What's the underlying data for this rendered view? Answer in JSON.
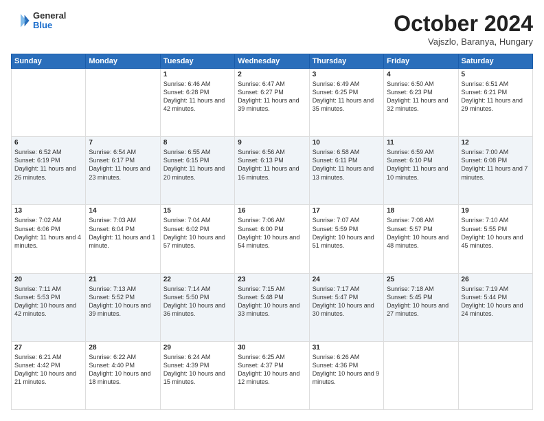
{
  "logo": {
    "general": "General",
    "blue": "Blue"
  },
  "title": "October 2024",
  "location": "Vajszlo, Baranya, Hungary",
  "days_of_week": [
    "Sunday",
    "Monday",
    "Tuesday",
    "Wednesday",
    "Thursday",
    "Friday",
    "Saturday"
  ],
  "weeks": [
    [
      {
        "day": "",
        "info": ""
      },
      {
        "day": "",
        "info": ""
      },
      {
        "day": "1",
        "info": "Sunrise: 6:46 AM\nSunset: 6:28 PM\nDaylight: 11 hours and 42 minutes."
      },
      {
        "day": "2",
        "info": "Sunrise: 6:47 AM\nSunset: 6:27 PM\nDaylight: 11 hours and 39 minutes."
      },
      {
        "day": "3",
        "info": "Sunrise: 6:49 AM\nSunset: 6:25 PM\nDaylight: 11 hours and 35 minutes."
      },
      {
        "day": "4",
        "info": "Sunrise: 6:50 AM\nSunset: 6:23 PM\nDaylight: 11 hours and 32 minutes."
      },
      {
        "day": "5",
        "info": "Sunrise: 6:51 AM\nSunset: 6:21 PM\nDaylight: 11 hours and 29 minutes."
      }
    ],
    [
      {
        "day": "6",
        "info": "Sunrise: 6:52 AM\nSunset: 6:19 PM\nDaylight: 11 hours and 26 minutes."
      },
      {
        "day": "7",
        "info": "Sunrise: 6:54 AM\nSunset: 6:17 PM\nDaylight: 11 hours and 23 minutes."
      },
      {
        "day": "8",
        "info": "Sunrise: 6:55 AM\nSunset: 6:15 PM\nDaylight: 11 hours and 20 minutes."
      },
      {
        "day": "9",
        "info": "Sunrise: 6:56 AM\nSunset: 6:13 PM\nDaylight: 11 hours and 16 minutes."
      },
      {
        "day": "10",
        "info": "Sunrise: 6:58 AM\nSunset: 6:11 PM\nDaylight: 11 hours and 13 minutes."
      },
      {
        "day": "11",
        "info": "Sunrise: 6:59 AM\nSunset: 6:10 PM\nDaylight: 11 hours and 10 minutes."
      },
      {
        "day": "12",
        "info": "Sunrise: 7:00 AM\nSunset: 6:08 PM\nDaylight: 11 hours and 7 minutes."
      }
    ],
    [
      {
        "day": "13",
        "info": "Sunrise: 7:02 AM\nSunset: 6:06 PM\nDaylight: 11 hours and 4 minutes."
      },
      {
        "day": "14",
        "info": "Sunrise: 7:03 AM\nSunset: 6:04 PM\nDaylight: 11 hours and 1 minute."
      },
      {
        "day": "15",
        "info": "Sunrise: 7:04 AM\nSunset: 6:02 PM\nDaylight: 10 hours and 57 minutes."
      },
      {
        "day": "16",
        "info": "Sunrise: 7:06 AM\nSunset: 6:00 PM\nDaylight: 10 hours and 54 minutes."
      },
      {
        "day": "17",
        "info": "Sunrise: 7:07 AM\nSunset: 5:59 PM\nDaylight: 10 hours and 51 minutes."
      },
      {
        "day": "18",
        "info": "Sunrise: 7:08 AM\nSunset: 5:57 PM\nDaylight: 10 hours and 48 minutes."
      },
      {
        "day": "19",
        "info": "Sunrise: 7:10 AM\nSunset: 5:55 PM\nDaylight: 10 hours and 45 minutes."
      }
    ],
    [
      {
        "day": "20",
        "info": "Sunrise: 7:11 AM\nSunset: 5:53 PM\nDaylight: 10 hours and 42 minutes."
      },
      {
        "day": "21",
        "info": "Sunrise: 7:13 AM\nSunset: 5:52 PM\nDaylight: 10 hours and 39 minutes."
      },
      {
        "day": "22",
        "info": "Sunrise: 7:14 AM\nSunset: 5:50 PM\nDaylight: 10 hours and 36 minutes."
      },
      {
        "day": "23",
        "info": "Sunrise: 7:15 AM\nSunset: 5:48 PM\nDaylight: 10 hours and 33 minutes."
      },
      {
        "day": "24",
        "info": "Sunrise: 7:17 AM\nSunset: 5:47 PM\nDaylight: 10 hours and 30 minutes."
      },
      {
        "day": "25",
        "info": "Sunrise: 7:18 AM\nSunset: 5:45 PM\nDaylight: 10 hours and 27 minutes."
      },
      {
        "day": "26",
        "info": "Sunrise: 7:19 AM\nSunset: 5:44 PM\nDaylight: 10 hours and 24 minutes."
      }
    ],
    [
      {
        "day": "27",
        "info": "Sunrise: 6:21 AM\nSunset: 4:42 PM\nDaylight: 10 hours and 21 minutes."
      },
      {
        "day": "28",
        "info": "Sunrise: 6:22 AM\nSunset: 4:40 PM\nDaylight: 10 hours and 18 minutes."
      },
      {
        "day": "29",
        "info": "Sunrise: 6:24 AM\nSunset: 4:39 PM\nDaylight: 10 hours and 15 minutes."
      },
      {
        "day": "30",
        "info": "Sunrise: 6:25 AM\nSunset: 4:37 PM\nDaylight: 10 hours and 12 minutes."
      },
      {
        "day": "31",
        "info": "Sunrise: 6:26 AM\nSunset: 4:36 PM\nDaylight: 10 hours and 9 minutes."
      },
      {
        "day": "",
        "info": ""
      },
      {
        "day": "",
        "info": ""
      }
    ]
  ]
}
